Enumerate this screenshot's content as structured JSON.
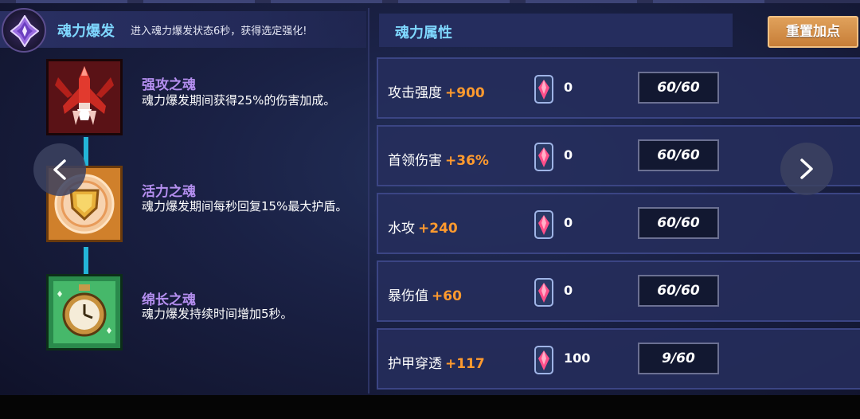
{
  "burst": {
    "title": "魂力爆发",
    "description": "进入魂力爆发状态6秒，获得选定强化!",
    "icon": "crystal-star-icon"
  },
  "souls": [
    {
      "name": "强攻之魂",
      "description": "魂力爆发期间获得25%的伤害加成。",
      "icon": "red-rocket-icon"
    },
    {
      "name": "活力之魂",
      "description": "魂力爆发期间每秒回复15%最大护盾。",
      "icon": "gold-shield-icon"
    },
    {
      "name": "绵长之魂",
      "description": "魂力爆发持续时间增加5秒。",
      "icon": "green-clock-icon"
    }
  ],
  "nav": {
    "prev_icon": "chevron-left-icon",
    "next_icon": "chevron-right-icon"
  },
  "attributes_panel": {
    "title": "魂力属性",
    "reset_label": "重置加点"
  },
  "attributes": [
    {
      "name": "攻击强度",
      "bonus": "+900",
      "count": "0",
      "points": "60/60"
    },
    {
      "name": "首领伤害",
      "bonus": "+36%",
      "count": "0",
      "points": "60/60"
    },
    {
      "name": "水攻",
      "bonus": "+240",
      "count": "0",
      "points": "60/60"
    },
    {
      "name": "暴伤值",
      "bonus": "+60",
      "count": "0",
      "points": "60/60"
    },
    {
      "name": "护甲穿透",
      "bonus": "+117",
      "count": "100",
      "points": "9/60"
    }
  ],
  "colors": {
    "accent_blue": "#7fd8ff",
    "soul_name": "#b58ff0",
    "bonus_orange": "#ff9a2e",
    "reset_button": "#d48e48"
  }
}
